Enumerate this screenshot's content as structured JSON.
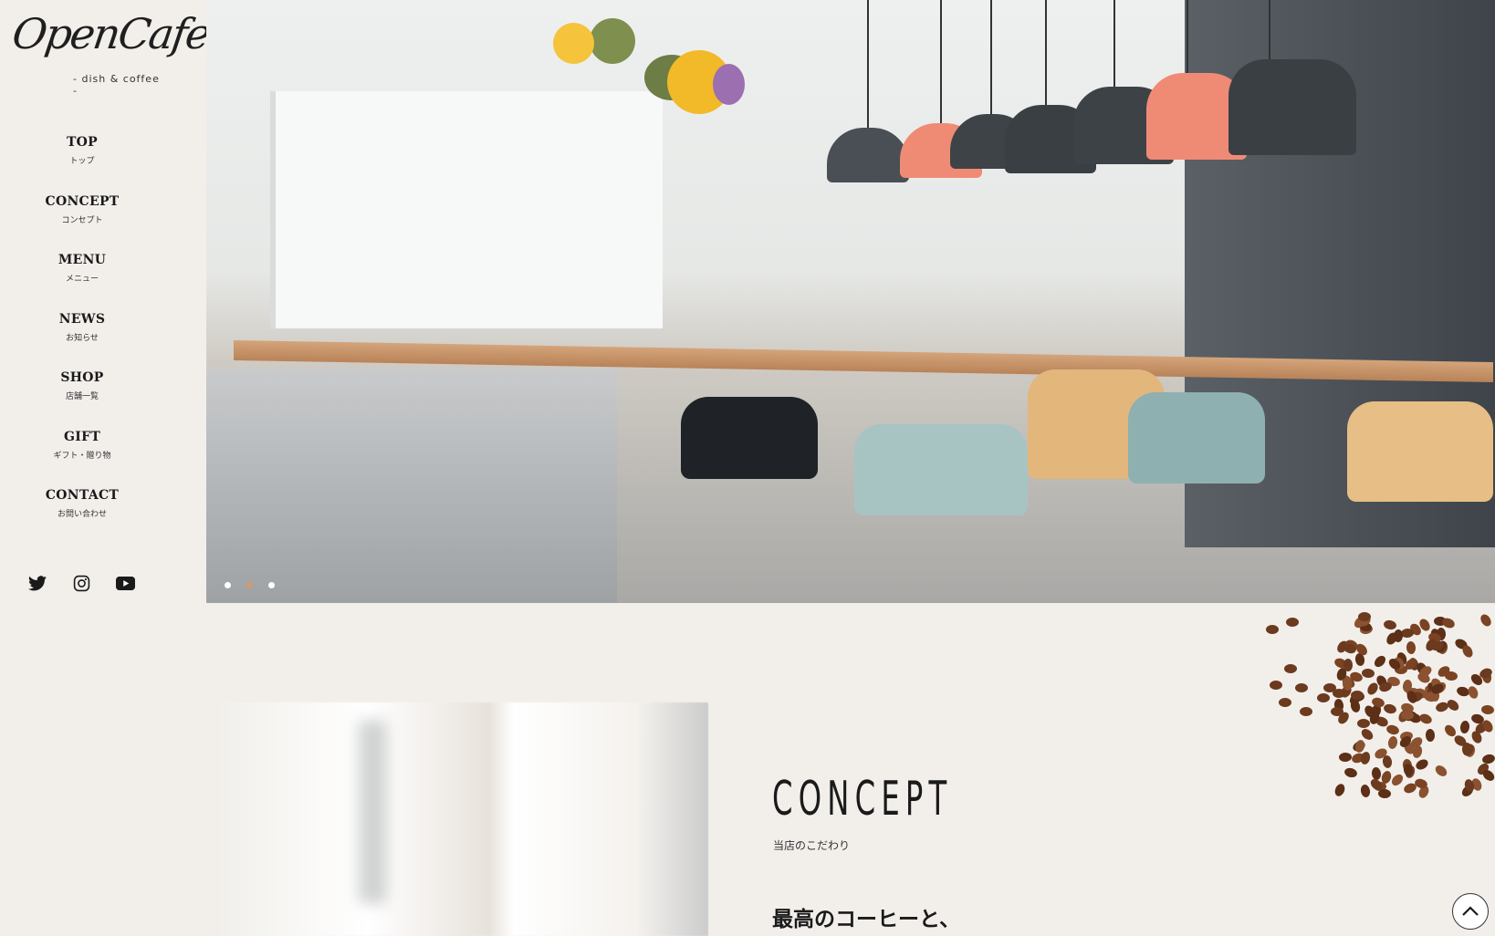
{
  "logo": {
    "script": "OpenCafe",
    "tagline": "- dish & coffee -"
  },
  "nav": [
    {
      "en": "TOP",
      "ja": "トップ"
    },
    {
      "en": "CONCEPT",
      "ja": "コンセプト"
    },
    {
      "en": "MENU",
      "ja": "メニュー"
    },
    {
      "en": "NEWS",
      "ja": "お知らせ"
    },
    {
      "en": "SHOP",
      "ja": "店舗一覧"
    },
    {
      "en": "GIFT",
      "ja": "ギフト・贈り物"
    },
    {
      "en": "CONTACT",
      "ja": "お問い合わせ"
    }
  ],
  "social": [
    "twitter-icon",
    "instagram-icon",
    "youtube-icon"
  ],
  "slider": {
    "count": 3,
    "active_index": 1,
    "accent": "#d39a6b"
  },
  "concept": {
    "title": "CONCEPT",
    "subtitle": "当店のこだわり",
    "heading": "最高のコーヒーと、"
  },
  "colors": {
    "background": "#f2efeb",
    "text": "#1f1f1f"
  }
}
